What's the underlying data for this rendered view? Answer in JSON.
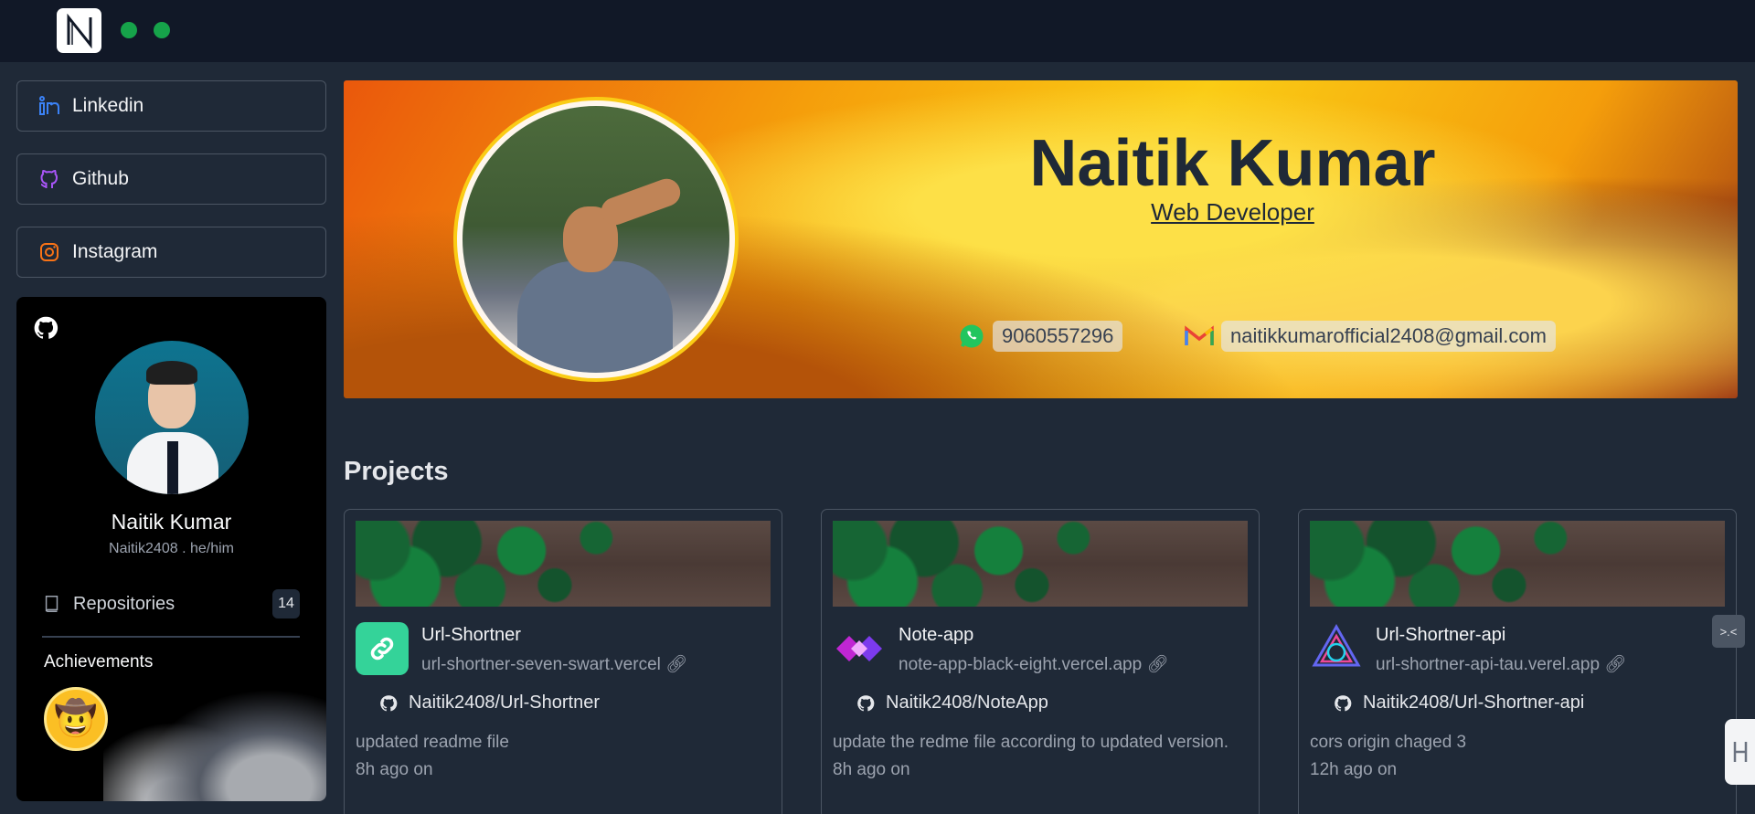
{
  "topbar": {
    "logo_letter": "N"
  },
  "sidebar": {
    "links": [
      {
        "label": "Linkedin",
        "icon": "linkedin-icon"
      },
      {
        "label": "Github",
        "icon": "github-icon"
      },
      {
        "label": "Instagram",
        "icon": "instagram-icon"
      }
    ],
    "github_card": {
      "name": "Naitik Kumar",
      "handle": "Naitik2408 . he/him",
      "repositories_label": "Repositories",
      "repositories_count": "14",
      "achievements_title": "Achievements"
    }
  },
  "hero": {
    "name": "Naitik Kumar",
    "role": "Web Developer",
    "phone": "9060557296",
    "email": "naitikkumarofficial2408@gmail.com"
  },
  "projects": {
    "title": "Projects",
    "items": [
      {
        "title": "Url-Shortner",
        "url": "url-shortner-seven-swart.vercel",
        "repo": "Naitik2408/Url-Shortner",
        "message": "updated readme file",
        "time": "8h ago on"
      },
      {
        "title": "Note-app",
        "url": "note-app-black-eight.vercel.app",
        "repo": "Naitik2408/NoteApp",
        "message": "update the redme file according to updated version.",
        "time": "8h ago on"
      },
      {
        "title": "Url-Shortner-api",
        "url": "url-shortner-api-tau.verel.app",
        "repo": "Naitik2408/Url-Shortner-api",
        "message": "cors origin chaged 3",
        "time": "12h ago on"
      }
    ]
  },
  "colors": {
    "topbar": "#111827",
    "background": "#1f2937",
    "accent_green": "#16a34a",
    "banner_yellow": "#facc15"
  }
}
